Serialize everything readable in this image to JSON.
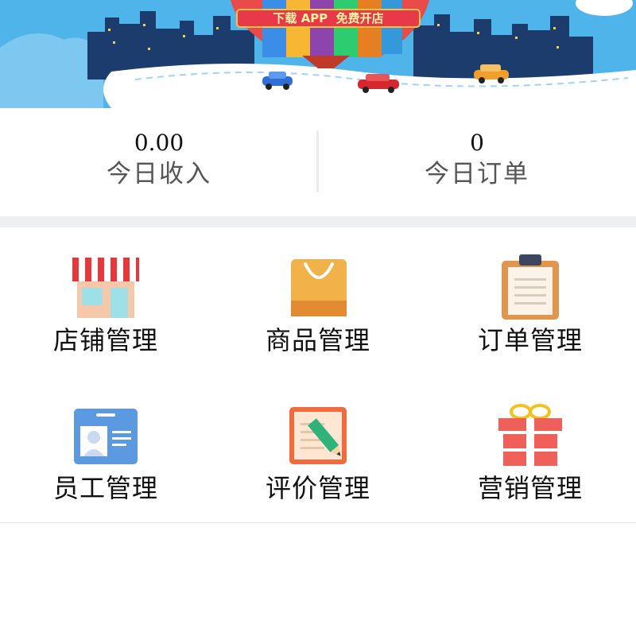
{
  "banner": {
    "download_text": "下载 APP  免费开店"
  },
  "stats": {
    "income": {
      "value": "0.00",
      "label": "今日收入"
    },
    "orders": {
      "value": "0",
      "label": "今日订单"
    }
  },
  "menu": {
    "items": [
      {
        "label": "店铺管理",
        "icon": "shop-icon"
      },
      {
        "label": "商品管理",
        "icon": "shopping-bag-icon"
      },
      {
        "label": "订单管理",
        "icon": "clipboard-icon"
      },
      {
        "label": "员工管理",
        "icon": "id-card-icon"
      },
      {
        "label": "评价管理",
        "icon": "review-pencil-icon"
      },
      {
        "label": "营销管理",
        "icon": "gift-icon"
      }
    ]
  },
  "colors": {
    "banner_sky": "#4fb4ea",
    "city": "#1d3c6e",
    "road": "#ffffff",
    "divider": "#eeeff1"
  }
}
